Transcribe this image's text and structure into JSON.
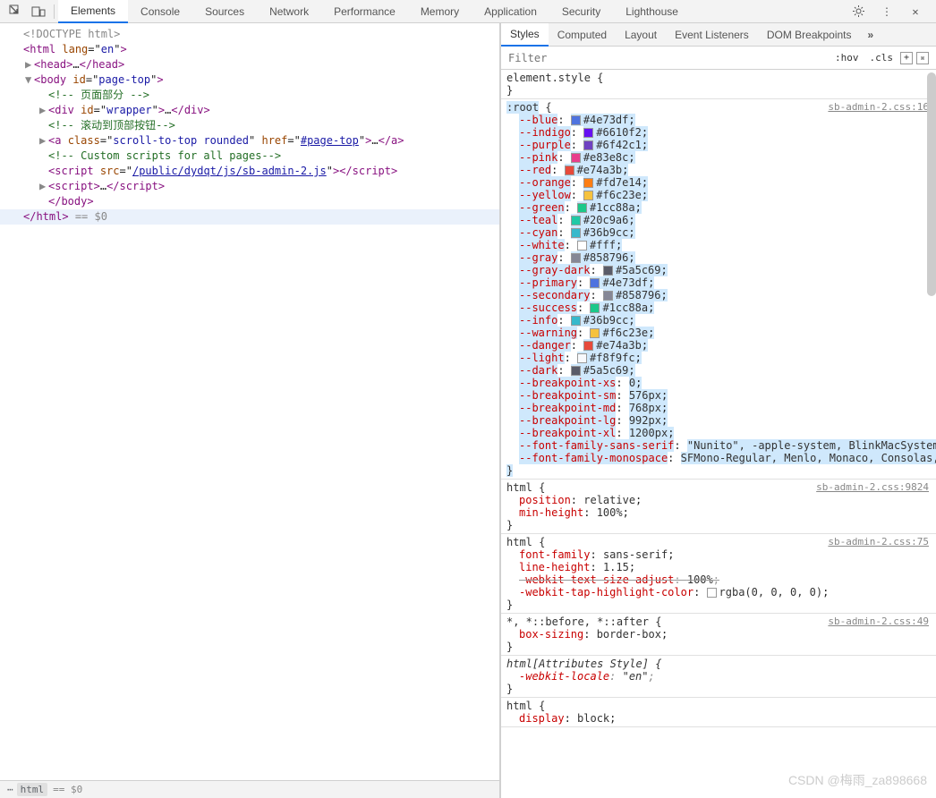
{
  "tabs": [
    "Elements",
    "Console",
    "Sources",
    "Network",
    "Performance",
    "Memory",
    "Application",
    "Security",
    "Lighthouse"
  ],
  "active_tab": 0,
  "sub_tabs": [
    "Styles",
    "Computed",
    "Layout",
    "Event Listeners",
    "DOM Breakpoints"
  ],
  "active_sub_tab": 0,
  "filter_placeholder": "Filter",
  "filter_right": [
    ":hov",
    ".cls",
    "+",
    "▭"
  ],
  "crumbs": [
    "…",
    "html"
  ],
  "crumbs_suffix": "== $0",
  "dom": [
    {
      "i": 0,
      "t": "<!DOCTYPE html>",
      "kind": "doctype"
    },
    {
      "i": 0,
      "t": "<html lang=\"en\">",
      "kind": "open",
      "attrs": [
        [
          "lang",
          "en"
        ]
      ],
      "tag": "html"
    },
    {
      "i": 1,
      "t": "<head>…</head>",
      "kind": "collapsed",
      "arrow": "▶",
      "tag": "head"
    },
    {
      "i": 1,
      "t": "<body id=\"page-top\">",
      "kind": "open",
      "arrow": "▼",
      "tag": "body",
      "attrs": [
        [
          "id",
          "page-top"
        ]
      ]
    },
    {
      "i": 2,
      "t": "<!-- 页面部分 -->",
      "kind": "comment"
    },
    {
      "i": 2,
      "t": "<div id=\"wrapper\">…</div>",
      "kind": "collapsed",
      "arrow": "▶",
      "tag": "div",
      "attrs": [
        [
          "id",
          "wrapper"
        ]
      ]
    },
    {
      "i": 2,
      "t": "<!-- 滚动到顶部按钮-->",
      "kind": "comment"
    },
    {
      "i": 2,
      "t": "<a class=\"scroll-to-top rounded\" href=\"#page-top\">…</a>",
      "kind": "collapsed",
      "arrow": "▶",
      "tag": "a",
      "attrs": [
        [
          "class",
          "scroll-to-top rounded"
        ],
        [
          "href",
          "#page-top"
        ]
      ],
      "href_link": true
    },
    {
      "i": 2,
      "t": "<!-- Custom scripts for all pages-->",
      "kind": "comment"
    },
    {
      "i": 2,
      "t": "<script src=\"/public/dydqt/js/sb-admin-2.js\"></script_>",
      "kind": "leaf",
      "tag": "script",
      "attrs": [
        [
          "src",
          "/public/dydqt/js/sb-admin-2.js"
        ]
      ],
      "src_link": true
    },
    {
      "i": 2,
      "t": "<script>…</script_>",
      "kind": "collapsed",
      "arrow": "▶",
      "tag": "script"
    },
    {
      "i": 2,
      "t": "</body>",
      "kind": "close",
      "tag": "body"
    },
    {
      "i": 0,
      "t": "</html>",
      "kind": "close",
      "tag": "html",
      "suffix": " == $0",
      "selected": true
    }
  ],
  "rules": [
    {
      "selector": "element.style",
      "header": "element.style {",
      "props": [],
      "close": "}",
      "src": ""
    },
    {
      "selector": ":root",
      "header": ":root {",
      "src": "sb-admin-2.css:16",
      "highlight": true,
      "props": [
        {
          "n": "--blue",
          "v": "#4e73df",
          "c": "#4e73df"
        },
        {
          "n": "--indigo",
          "v": "#6610f2",
          "c": "#6610f2"
        },
        {
          "n": "--purple",
          "v": "#6f42c1",
          "c": "#6f42c1"
        },
        {
          "n": "--pink",
          "v": "#e83e8c",
          "c": "#e83e8c"
        },
        {
          "n": "--red",
          "v": "#e74a3b",
          "c": "#e74a3b"
        },
        {
          "n": "--orange",
          "v": "#fd7e14",
          "c": "#fd7e14"
        },
        {
          "n": "--yellow",
          "v": "#f6c23e",
          "c": "#f6c23e"
        },
        {
          "n": "--green",
          "v": "#1cc88a",
          "c": "#1cc88a"
        },
        {
          "n": "--teal",
          "v": "#20c9a6",
          "c": "#20c9a6"
        },
        {
          "n": "--cyan",
          "v": "#36b9cc",
          "c": "#36b9cc"
        },
        {
          "n": "--white",
          "v": "#fff",
          "c": "#fff"
        },
        {
          "n": "--gray",
          "v": "#858796",
          "c": "#858796"
        },
        {
          "n": "--gray-dark",
          "v": "#5a5c69",
          "c": "#5a5c69"
        },
        {
          "n": "--primary",
          "v": "#4e73df",
          "c": "#4e73df"
        },
        {
          "n": "--secondary",
          "v": "#858796",
          "c": "#858796"
        },
        {
          "n": "--success",
          "v": "#1cc88a",
          "c": "#1cc88a"
        },
        {
          "n": "--info",
          "v": "#36b9cc",
          "c": "#36b9cc"
        },
        {
          "n": "--warning",
          "v": "#f6c23e",
          "c": "#f6c23e"
        },
        {
          "n": "--danger",
          "v": "#e74a3b",
          "c": "#e74a3b"
        },
        {
          "n": "--light",
          "v": "#f8f9fc",
          "c": "#f8f9fc"
        },
        {
          "n": "--dark",
          "v": "#5a5c69",
          "c": "#5a5c69"
        },
        {
          "n": "--breakpoint-xs",
          "v": "0"
        },
        {
          "n": "--breakpoint-sm",
          "v": "576px"
        },
        {
          "n": "--breakpoint-md",
          "v": "768px"
        },
        {
          "n": "--breakpoint-lg",
          "v": "992px"
        },
        {
          "n": "--breakpoint-xl",
          "v": "1200px"
        },
        {
          "n": "--font-family-sans-serif",
          "v": "\"Nunito\", -apple-system, BlinkMacSystemFont, \"Segoe UI\", Roboto, \"Helvetica Neue\", Arial, sans-serif, \"Apple Color Emoji\", \"Segoe UI Emoji\", \"Segoe UI Symbol\", \"Noto Color Emoji\""
        },
        {
          "n": "--font-family-monospace",
          "v": "SFMono-Regular, Menlo, Monaco, Consolas, \"Liberation Mono\", \"Courier New\", monospace"
        }
      ],
      "close": "}"
    },
    {
      "selector": "html",
      "header": "html {",
      "src": "sb-admin-2.css:9824",
      "props": [
        {
          "n": "position",
          "v": "relative"
        },
        {
          "n": "min-height",
          "v": "100%"
        }
      ],
      "close": "}"
    },
    {
      "selector": "html",
      "header": "html {",
      "src": "sb-admin-2.css:75",
      "props": [
        {
          "n": "font-family",
          "v": "sans-serif"
        },
        {
          "n": "line-height",
          "v": "1.15"
        },
        {
          "n": "-webkit-text-size-adjust",
          "v": "100%",
          "strike": true
        },
        {
          "n": "-webkit-tap-highlight-color",
          "v": "rgba(0, 0, 0, 0)",
          "c": "rgba(0,0,0,0)"
        }
      ],
      "close": "}"
    },
    {
      "selector": "*, *::before, *::after",
      "header": "*, *::before, *::after {",
      "src": "sb-admin-2.css:49",
      "props": [
        {
          "n": "box-sizing",
          "v": "border-box"
        }
      ],
      "close": "}"
    },
    {
      "selector": "html[Attributes Style]",
      "header": "html[Attributes Style] {",
      "italic": true,
      "props": [
        {
          "n": "-webkit-locale",
          "v": "\"en\"",
          "italic": true
        }
      ],
      "close": "}"
    },
    {
      "selector": "html",
      "header": "html {",
      "src": "",
      "props": [
        {
          "n": "display",
          "v": "block",
          "partial": true
        }
      ],
      "close": ""
    }
  ],
  "watermark": "CSDN @梅雨_za898668"
}
